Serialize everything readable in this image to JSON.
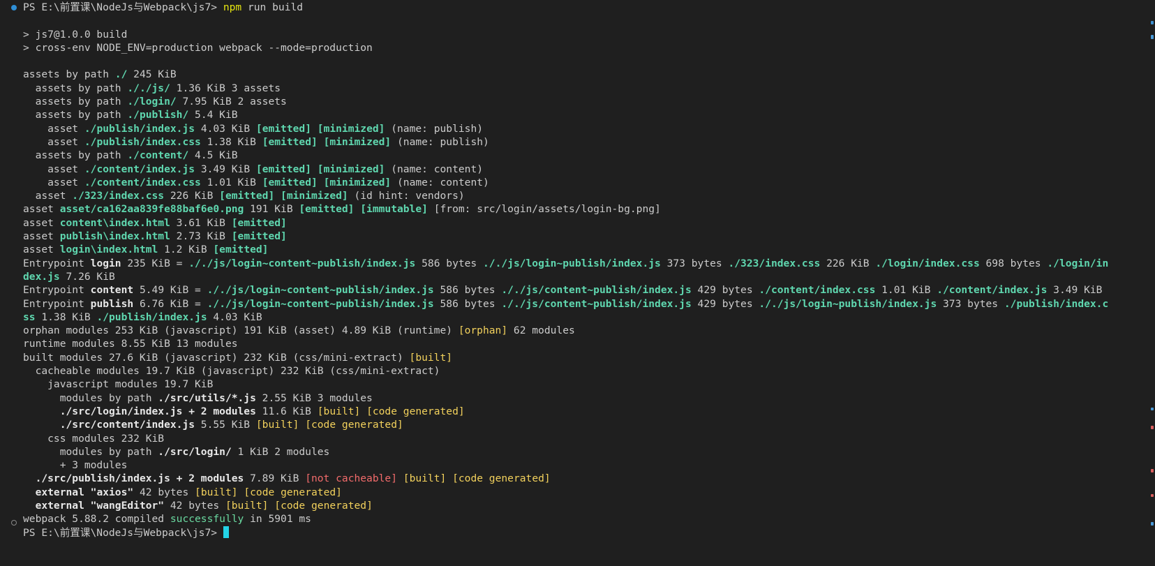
{
  "terminal": {
    "prompt_path": "PS E:\\前置课\\NodeJs与Webpack\\js7>",
    "command": "npm run build",
    "final_prompt": "PS E:\\前置课\\NodeJs与Webpack\\js7>",
    "colors": {
      "background": "#1f1f1f",
      "text": "#cccccc",
      "green": "#5fd7af",
      "yellow": "#f2d15c",
      "red": "#f26b6b",
      "cursor": "#23d3e6",
      "command_yellow": "#e5e510"
    }
  },
  "lines": [
    [
      [
        "p",
        "PS E:\\前置课\\NodeJs与Webpack\\js7> "
      ],
      [
        "c",
        "npm"
      ],
      [
        "p",
        " run build"
      ]
    ],
    [],
    [
      [
        "p",
        "> js7@1.0.0 build"
      ]
    ],
    [
      [
        "p",
        "> cross-env NODE_ENV=production webpack --mode=production"
      ]
    ],
    [],
    [
      [
        "p",
        "assets by path "
      ],
      [
        "g",
        "./"
      ],
      [
        "p",
        " 245 KiB"
      ]
    ],
    [
      [
        "p",
        "  assets by path "
      ],
      [
        "g",
        "./"
      ],
      [
        "g",
        "./js/"
      ],
      [
        "p",
        " 1.36 KiB 3 assets"
      ]
    ],
    [
      [
        "p",
        "  assets by path "
      ],
      [
        "g",
        "./login/"
      ],
      [
        "p",
        " 7.95 KiB 2 assets"
      ]
    ],
    [
      [
        "p",
        "  assets by path "
      ],
      [
        "g",
        "./publish/"
      ],
      [
        "p",
        " 5.4 KiB"
      ]
    ],
    [
      [
        "p",
        "    asset "
      ],
      [
        "g",
        "./publish/index.js"
      ],
      [
        "p",
        " 4.03 KiB "
      ],
      [
        "g",
        "[emitted]"
      ],
      [
        "p",
        " "
      ],
      [
        "g",
        "[minimized]"
      ],
      [
        "p",
        " (name: publish)"
      ]
    ],
    [
      [
        "p",
        "    asset "
      ],
      [
        "g",
        "./publish/index.css"
      ],
      [
        "p",
        " 1.38 KiB "
      ],
      [
        "g",
        "[emitted]"
      ],
      [
        "p",
        " "
      ],
      [
        "g",
        "[minimized]"
      ],
      [
        "p",
        " (name: publish)"
      ]
    ],
    [
      [
        "p",
        "  assets by path "
      ],
      [
        "g",
        "./content/"
      ],
      [
        "p",
        " 4.5 KiB"
      ]
    ],
    [
      [
        "p",
        "    asset "
      ],
      [
        "g",
        "./content/index.js"
      ],
      [
        "p",
        " 3.49 KiB "
      ],
      [
        "g",
        "[emitted]"
      ],
      [
        "p",
        " "
      ],
      [
        "g",
        "[minimized]"
      ],
      [
        "p",
        " (name: content)"
      ]
    ],
    [
      [
        "p",
        "    asset "
      ],
      [
        "g",
        "./content/index.css"
      ],
      [
        "p",
        " 1.01 KiB "
      ],
      [
        "g",
        "[emitted]"
      ],
      [
        "p",
        " "
      ],
      [
        "g",
        "[minimized]"
      ],
      [
        "p",
        " (name: content)"
      ]
    ],
    [
      [
        "p",
        "  asset "
      ],
      [
        "g",
        "./323/index.css"
      ],
      [
        "p",
        " 226 KiB "
      ],
      [
        "g",
        "[emitted]"
      ],
      [
        "p",
        " "
      ],
      [
        "g",
        "[minimized]"
      ],
      [
        "p",
        " (id hint: vendors)"
      ]
    ],
    [
      [
        "p",
        "asset "
      ],
      [
        "g",
        "asset/ca162aa839fe88baf6e0.png"
      ],
      [
        "p",
        " 191 KiB "
      ],
      [
        "g",
        "[emitted]"
      ],
      [
        "p",
        " "
      ],
      [
        "g",
        "[immutable]"
      ],
      [
        "p",
        " [from: src/login/assets/login-bg.png]"
      ]
    ],
    [
      [
        "p",
        "asset "
      ],
      [
        "g",
        "content\\index.html"
      ],
      [
        "p",
        " 3.61 KiB "
      ],
      [
        "g",
        "[emitted]"
      ]
    ],
    [
      [
        "p",
        "asset "
      ],
      [
        "g",
        "publish\\index.html"
      ],
      [
        "p",
        " 2.73 KiB "
      ],
      [
        "g",
        "[emitted]"
      ]
    ],
    [
      [
        "p",
        "asset "
      ],
      [
        "g",
        "login\\index.html"
      ],
      [
        "p",
        " 1.2 KiB "
      ],
      [
        "g",
        "[emitted]"
      ]
    ],
    [
      [
        "p",
        "Entrypoint "
      ],
      [
        "b",
        "login"
      ],
      [
        "p",
        " 235 KiB = "
      ],
      [
        "g",
        "./"
      ],
      [
        "g",
        "./js/login~content~publish/index.js"
      ],
      [
        "p",
        " 586 bytes "
      ],
      [
        "g",
        "./"
      ],
      [
        "g",
        "./js/login~publish/index.js"
      ],
      [
        "p",
        " 373 bytes "
      ],
      [
        "g",
        "./323/index.css"
      ],
      [
        "p",
        " 226 KiB "
      ],
      [
        "g",
        "./login/index.css"
      ],
      [
        "p",
        " 698 bytes "
      ],
      [
        "g",
        "./login/in"
      ]
    ],
    [
      [
        "g",
        "dex.js"
      ],
      [
        "p",
        " 7.26 KiB"
      ]
    ],
    [
      [
        "p",
        "Entrypoint "
      ],
      [
        "b",
        "content"
      ],
      [
        "p",
        " 5.49 KiB = "
      ],
      [
        "g",
        "./"
      ],
      [
        "g",
        "./js/login~content~publish/index.js"
      ],
      [
        "p",
        " 586 bytes "
      ],
      [
        "g",
        "./"
      ],
      [
        "g",
        "./js/content~publish/index.js"
      ],
      [
        "p",
        " 429 bytes "
      ],
      [
        "g",
        "./content/index.css"
      ],
      [
        "p",
        " 1.01 KiB "
      ],
      [
        "g",
        "./content/index.js"
      ],
      [
        "p",
        " 3.49 KiB"
      ]
    ],
    [
      [
        "p",
        "Entrypoint "
      ],
      [
        "b",
        "publish"
      ],
      [
        "p",
        " 6.76 KiB = "
      ],
      [
        "g",
        "./"
      ],
      [
        "g",
        "./js/login~content~publish/index.js"
      ],
      [
        "p",
        " 586 bytes "
      ],
      [
        "g",
        "./"
      ],
      [
        "g",
        "./js/content~publish/index.js"
      ],
      [
        "p",
        " 429 bytes "
      ],
      [
        "g",
        "./"
      ],
      [
        "g",
        "./js/login~publish/index.js"
      ],
      [
        "p",
        " 373 bytes "
      ],
      [
        "g",
        "./publish/index.c"
      ]
    ],
    [
      [
        "g",
        "ss"
      ],
      [
        "p",
        " 1.38 KiB "
      ],
      [
        "g",
        "./publish/index.js"
      ],
      [
        "p",
        " 4.03 KiB"
      ]
    ],
    [
      [
        "p",
        "orphan modules 253 KiB (javascript) 191 KiB (asset) 4.89 KiB (runtime) "
      ],
      [
        "y",
        "[orphan]"
      ],
      [
        "p",
        " 62 modules"
      ]
    ],
    [
      [
        "p",
        "runtime modules 8.55 KiB 13 modules"
      ]
    ],
    [
      [
        "p",
        "built modules 27.6 KiB (javascript) 232 KiB (css/mini-extract) "
      ],
      [
        "y",
        "[built]"
      ]
    ],
    [
      [
        "p",
        "  cacheable modules 19.7 KiB (javascript) 232 KiB (css/mini-extract)"
      ]
    ],
    [
      [
        "p",
        "    javascript modules 19.7 KiB"
      ]
    ],
    [
      [
        "p",
        "      modules by path "
      ],
      [
        "b",
        "./src/utils/*.js"
      ],
      [
        "p",
        " 2.55 KiB 3 modules"
      ]
    ],
    [
      [
        "p",
        "      "
      ],
      [
        "b",
        "./src/login/index.js + 2 modules"
      ],
      [
        "p",
        " 11.6 KiB "
      ],
      [
        "y",
        "[built]"
      ],
      [
        "p",
        " "
      ],
      [
        "y",
        "[code generated]"
      ]
    ],
    [
      [
        "p",
        "      "
      ],
      [
        "b",
        "./src/content/index.js"
      ],
      [
        "p",
        " 5.55 KiB "
      ],
      [
        "y",
        "[built]"
      ],
      [
        "p",
        " "
      ],
      [
        "y",
        "[code generated]"
      ]
    ],
    [
      [
        "p",
        "    css modules 232 KiB"
      ]
    ],
    [
      [
        "p",
        "      modules by path "
      ],
      [
        "b",
        "./src/login/"
      ],
      [
        "p",
        " 1 KiB 2 modules"
      ]
    ],
    [
      [
        "p",
        "      + 3 modules"
      ]
    ],
    [
      [
        "p",
        "  "
      ],
      [
        "b",
        "./src/publish/index.js + 2 modules"
      ],
      [
        "p",
        " 7.89 KiB "
      ],
      [
        "r",
        "[not cacheable]"
      ],
      [
        "p",
        " "
      ],
      [
        "y",
        "[built]"
      ],
      [
        "p",
        " "
      ],
      [
        "y",
        "[code generated]"
      ]
    ],
    [
      [
        "p",
        "  "
      ],
      [
        "b",
        "external \"axios\""
      ],
      [
        "p",
        " 42 bytes "
      ],
      [
        "y",
        "[built]"
      ],
      [
        "p",
        " "
      ],
      [
        "y",
        "[code generated]"
      ]
    ],
    [
      [
        "p",
        "  "
      ],
      [
        "b",
        "external \"wangEditor\""
      ],
      [
        "p",
        " 42 bytes "
      ],
      [
        "y",
        "[built]"
      ],
      [
        "p",
        " "
      ],
      [
        "y",
        "[code generated]"
      ]
    ],
    [
      [
        "p",
        "webpack 5.88.2 compiled "
      ],
      [
        "gn",
        "successfully"
      ],
      [
        "p",
        " in 5901 ms"
      ]
    ],
    [
      [
        "p",
        "PS E:\\前置课\\NodeJs与Webpack\\js7> "
      ],
      [
        "cursor",
        ""
      ]
    ]
  ]
}
